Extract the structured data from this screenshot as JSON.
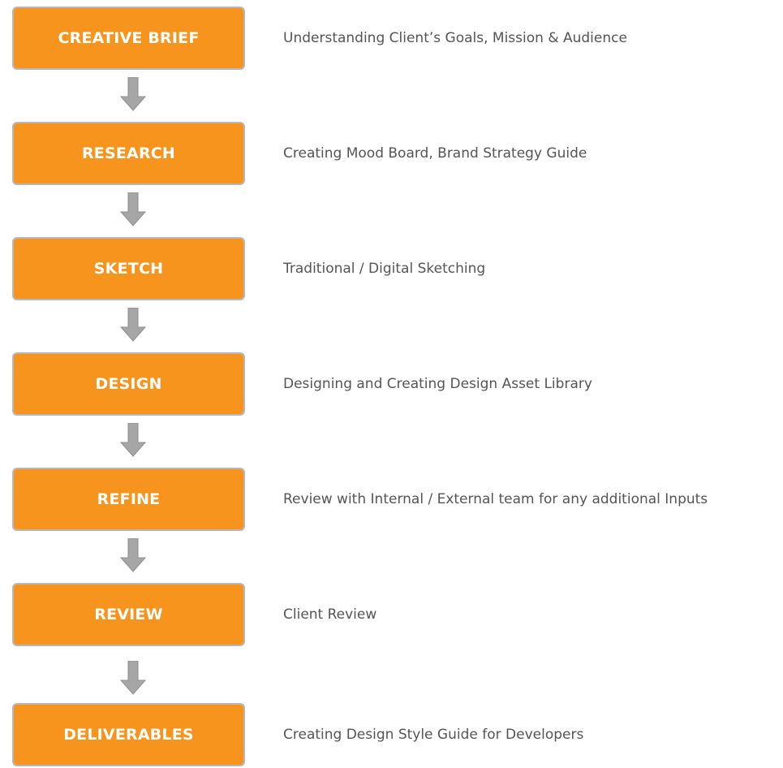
{
  "steps": [
    {
      "label": "CREATIVE BRIEF",
      "description": "Understanding Client’s Goals, Mission & Audience"
    },
    {
      "label": "RESEARCH",
      "description": "Creating Mood Board, Brand Strategy Guide"
    },
    {
      "label": "SKETCH",
      "description": "Traditional / Digital Sketching"
    },
    {
      "label": "DESIGN",
      "description": "Designing and Creating Design Asset Library"
    },
    {
      "label": "REFINE",
      "description": "Review with Internal / External team for any additional Inputs"
    },
    {
      "label": "REVIEW",
      "description": "Client Review"
    },
    {
      "label": "DELIVERABLES",
      "description": "Creating Design Style Guide for Developers"
    }
  ],
  "colors": {
    "box_fill": "#f7941d",
    "box_border": "#b8b8b8",
    "box_text": "#ffffff",
    "arrow": "#a6a6a6",
    "description_text": "#555555"
  },
  "icons": {
    "connector": "down-arrow-icon"
  }
}
